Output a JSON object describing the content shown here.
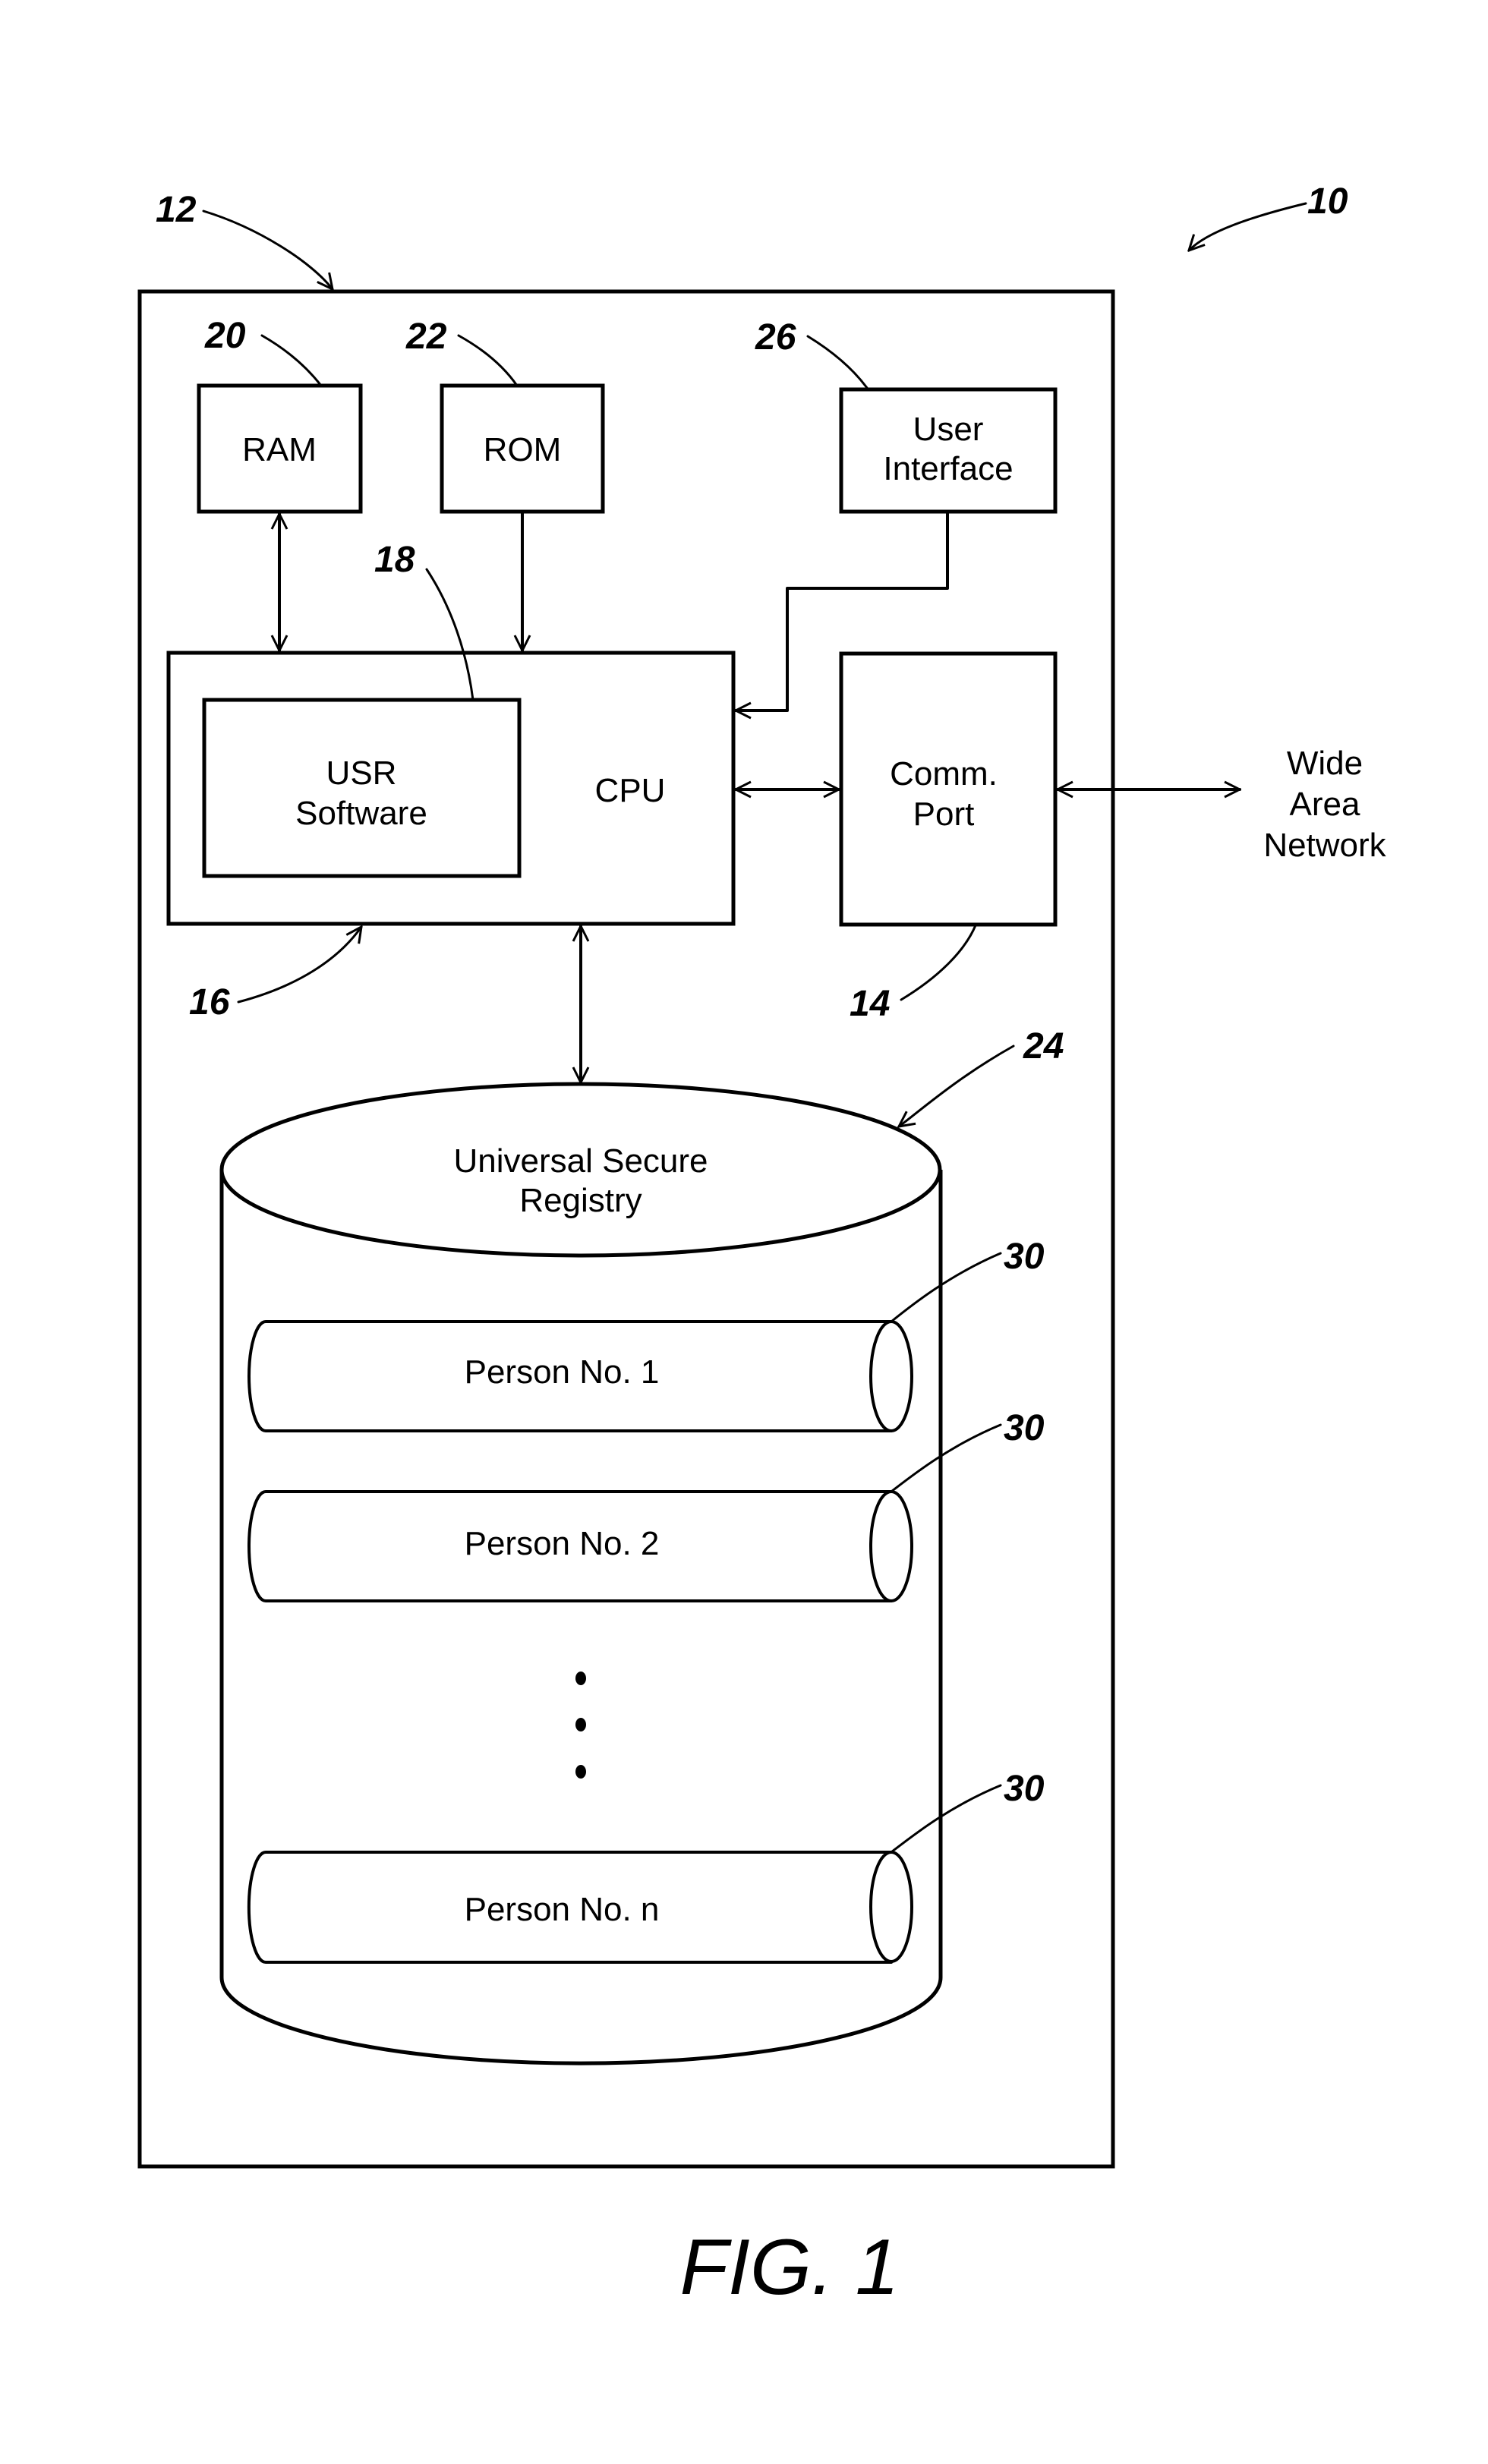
{
  "figure": {
    "caption": "FIG. 1",
    "system_ref": "10",
    "computer_ref": "12"
  },
  "components": {
    "ram": {
      "label": "RAM",
      "ref": "20"
    },
    "rom": {
      "label": "ROM",
      "ref": "22"
    },
    "user_interface": {
      "label_lines": [
        "User",
        "Interface"
      ],
      "ref": "26"
    },
    "cpu": {
      "label": "CPU",
      "ref": "16"
    },
    "usr_software": {
      "label_lines": [
        "USR",
        "Software"
      ],
      "ref": "18"
    },
    "comm_port": {
      "label_lines": [
        "Comm.",
        "Port"
      ],
      "ref": "14"
    },
    "wide_area_network": {
      "label_lines": [
        "Wide",
        "Area",
        "Network"
      ]
    },
    "registry": {
      "label_lines": [
        "Universal Secure",
        "Registry"
      ],
      "ref": "24",
      "records": [
        {
          "label": "Person No. 1",
          "ref": "30"
        },
        {
          "label": "Person No. 2",
          "ref": "30"
        },
        {
          "label": "Person No. n",
          "ref": "30"
        }
      ],
      "ellipsis": "⋮"
    }
  },
  "connections": [
    {
      "from": "RAM",
      "to": "CPU",
      "direction": "bidirectional"
    },
    {
      "from": "ROM",
      "to": "CPU",
      "direction": "one-way"
    },
    {
      "from": "User Interface",
      "to": "CPU",
      "direction": "one-way"
    },
    {
      "from": "CPU",
      "to": "Comm. Port",
      "direction": "bidirectional"
    },
    {
      "from": "Comm. Port",
      "to": "Wide Area Network",
      "direction": "bidirectional"
    },
    {
      "from": "CPU",
      "to": "Universal Secure Registry",
      "direction": "bidirectional"
    }
  ]
}
